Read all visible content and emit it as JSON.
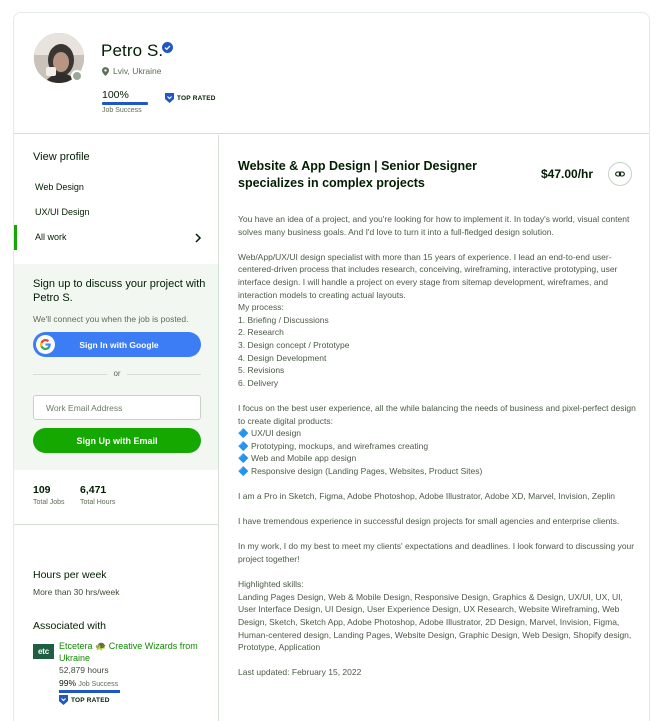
{
  "profile": {
    "name": "Petro S.",
    "location": "Lviv, Ukraine",
    "job_success_value": "100%",
    "job_success_label": "Job Success",
    "top_rated": "TOP RATED"
  },
  "sidebar": {
    "view_profile": "View profile",
    "nav": [
      {
        "label": "Web Design"
      },
      {
        "label": "UX/UI Design"
      },
      {
        "label": "All work"
      }
    ],
    "signup": {
      "title": "Sign up to discuss your project with Petro S.",
      "subtitle": "We'll connect you when the job is posted.",
      "google_label": "Sign In with Google",
      "or": "or",
      "email_placeholder": "Work Email Address",
      "email_button": "Sign Up with Email"
    },
    "stats": [
      {
        "value": "109",
        "label": "Total Jobs"
      },
      {
        "value": "6,471",
        "label": "Total Hours"
      }
    ],
    "hours_title": "Hours per week",
    "hours_value": "More than 30 hrs/week",
    "associated_title": "Associated with",
    "agency": {
      "logo_text": "etc",
      "name": "Etcetera 🐢 Creative Wizards from Ukraine",
      "hours": "52,879 hours",
      "job_success_value": "99%",
      "job_success_label": "Job Success",
      "top_rated": "TOP RATED"
    }
  },
  "main": {
    "title": "Website & App Design | Senior Designer specializes in complex projects",
    "rate": "$47.00/hr",
    "link_icon": "link-icon",
    "paragraphs": [
      [
        "You have an idea of a project, and you're looking for how to implement it. In today's world, visual content solves many business goals. And I'd love to turn it into a full-fledged design solution."
      ],
      [
        "Web/App/UX/UI design specialist with more than 15 years of experience. I lead an end-to-end user-centered-driven process that includes research, conceiving, wireframing, interactive prototyping, user interface design. I will handle a project on every stage from sitemap development, wireframes, and interaction models to creating actual layouts.",
        "My process:",
        "1. Briefing / Discussions",
        "2. Research",
        "3. Design concept / Prototype",
        "4. Design Development",
        "5. Revisions",
        "6. Delivery"
      ],
      [
        "I focus on the best user experience, all the while balancing the needs of business and pixel-perfect design to create digital products:",
        "🔷 UX/UI design",
        "🔷 Prototyping, mockups, and wireframes creating",
        "🔷 Web and Mobile app design",
        "🔷 Responsive design (Landing Pages, Websites, Product Sites)"
      ],
      [
        "I am a Pro in Sketch, Figma, Adobe Photoshop, Adobe Illustrator, Adobe XD, Marvel, Invision, Zeplin"
      ],
      [
        "I have tremendous experience in successful design projects for small agencies and enterprise clients."
      ],
      [
        "In my work, I do my best to meet my clients' expectations and deadlines. I look forward to discussing your project together!"
      ],
      [
        "Highlighted skills:",
        "Landing Pages Design, Web & Mobile Design, Responsive Design, Graphics & Design, UX/UI, UX, UI, User Interface Design, UI Design, User Experience Design, UX Research, Website Wireframing, Web Design, Sketch, Sketch App, Adobe Photoshop, Adobe Illustrator, 2D Design, Marvel, Invision, Figma, Human-centered design, Landing Pages, Website Design, Graphic Design, Web Design, Shopify design, Prototype, Application"
      ],
      [
        "Last updated: February 15, 2022"
      ]
    ]
  },
  "colors": {
    "brand_green": "#14a800",
    "link_green": "#108a00",
    "google_blue": "#3c7df6",
    "job_success_blue": "#1f57c3"
  }
}
